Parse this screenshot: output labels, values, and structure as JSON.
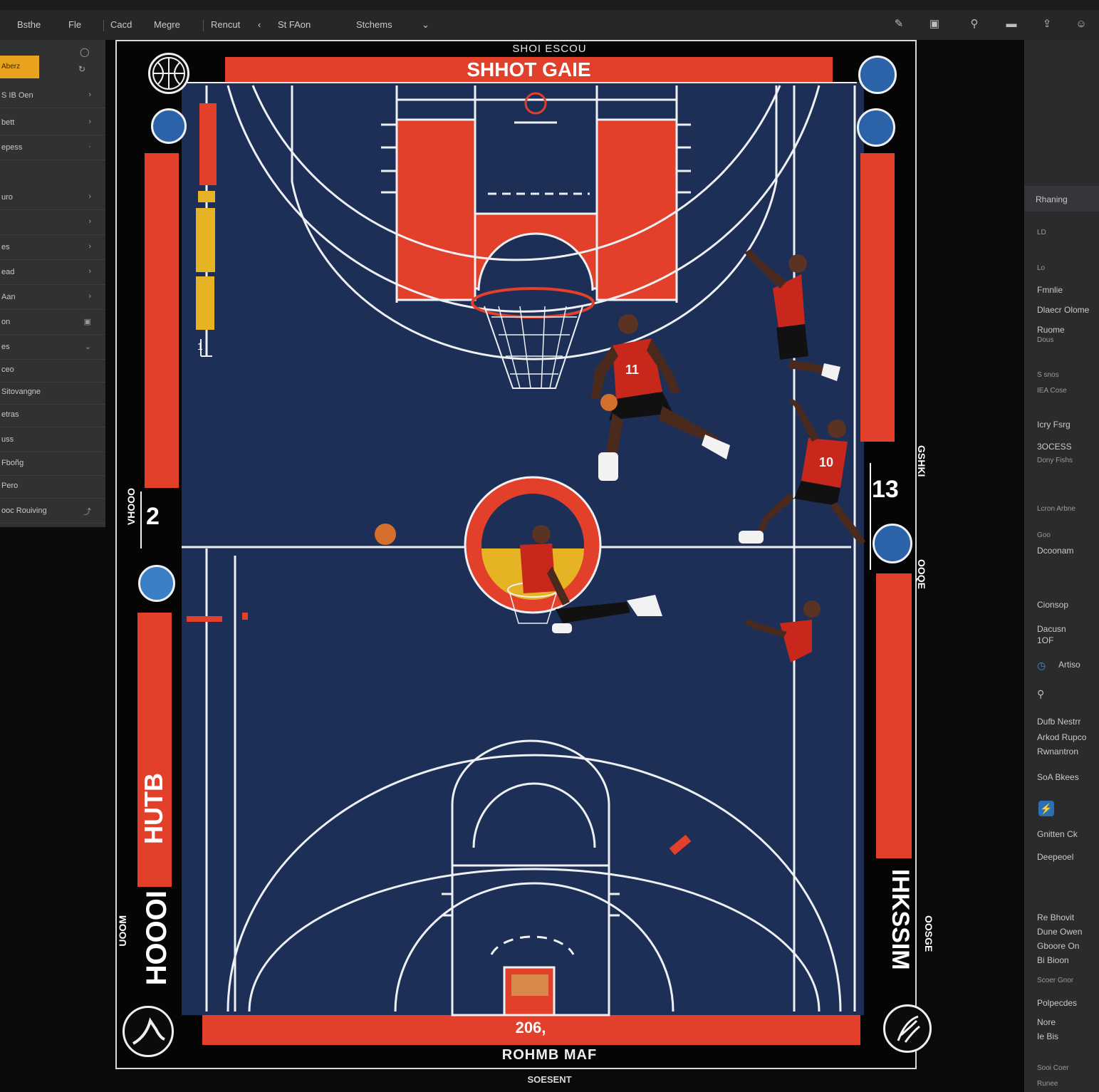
{
  "menubar": {
    "items": [
      "Bsthe",
      "Fle",
      "Cacd",
      "Megre",
      "Rencut",
      "St FAon",
      "Stchems"
    ],
    "tools": [
      "pen-icon",
      "layers-icon",
      "pin-icon",
      "toggle-icon",
      "share-icon",
      "user-icon"
    ]
  },
  "left_panel": {
    "active_item": "Aberz",
    "items": [
      {
        "label": "S IB Oen",
        "chevron": "›"
      },
      {
        "label": "bett",
        "chevron": "›"
      },
      {
        "label": "epess",
        "chevron": "·"
      },
      {
        "label": "uro",
        "chevron": "›"
      },
      {
        "label": "",
        "chevron": "›"
      },
      {
        "label": "es",
        "chevron": "›"
      },
      {
        "label": "ead",
        "chevron": "›"
      },
      {
        "label": "Aan",
        "chevron": "›"
      },
      {
        "label": "on",
        "chevron": "▣"
      },
      {
        "label": "es",
        "chevron": "⌄"
      },
      {
        "label": "ceo",
        "chevron": ""
      },
      {
        "label": "Sitovangne",
        "chevron": ""
      },
      {
        "label": "etras",
        "chevron": ""
      },
      {
        "label": "uss",
        "chevron": ""
      },
      {
        "label": "Fboñg",
        "chevron": ""
      },
      {
        "label": "Pero",
        "chevron": ""
      },
      {
        "label": "ooc Rouiving",
        "chevron": "⤴"
      }
    ]
  },
  "document": {
    "subtitle": "SHOI ESCOU",
    "banner_title": "SHHOT GAIE",
    "score_left": "2",
    "score_right": "13",
    "bottom_year": "206,",
    "footer_title": "ROHMB MAF",
    "footer_sub": "SOESENT",
    "left_vertical_main": "HOOOI",
    "left_vertical_orange": "HUTB",
    "left_vertical_small": "VHOOO",
    "left_vertical_small_bottom": "UOOM",
    "right_vertical_main": "IHKSSIM",
    "right_vertical_top": "GSHKI",
    "right_vertical_mid": "OOQE",
    "right_vertical_bottom": "OOSGE",
    "lane_label": "1",
    "jersey_numbers": [
      "11",
      "10"
    ],
    "logos": [
      "ball-logo",
      "team-logo-1",
      "team-logo-2",
      "team-logo-3",
      "team-logo-4",
      "team-logo-5",
      "swoosh-logo-left",
      "swoosh-logo-right"
    ]
  },
  "right_panel": {
    "header": "Rhaning",
    "entries": [
      {
        "text": "LD",
        "type": "sub"
      },
      {
        "text": "Lo",
        "type": "sub"
      },
      {
        "text": "Fmnlie",
        "type": "text"
      },
      {
        "text": "Dlaecr Olome",
        "type": "text"
      },
      {
        "text": "Ruome",
        "type": "text"
      },
      {
        "text": "Dous",
        "type": "sub"
      },
      {
        "text": "S snos",
        "type": "sub"
      },
      {
        "text": "IEA Cose",
        "type": "sub"
      },
      {
        "text": "Icry Fsrg",
        "type": "text"
      },
      {
        "text": "3OCESS",
        "type": "text"
      },
      {
        "text": "Dony Fishs",
        "type": "sub"
      },
      {
        "text": "Lcron Arbne",
        "type": "sub"
      },
      {
        "text": "Goo",
        "type": "sub"
      },
      {
        "text": "Dcoonam",
        "type": "text"
      },
      {
        "text": "Cionsop",
        "type": "text"
      },
      {
        "text": "Dacusn",
        "type": "text"
      },
      {
        "text": "1OF",
        "type": "text"
      },
      {
        "text": "Artiso",
        "type": "text"
      },
      {
        "text": "Dufb Nestrr",
        "type": "text"
      },
      {
        "text": "Arkod Rupco",
        "type": "text"
      },
      {
        "text": "Rwnantron",
        "type": "text"
      },
      {
        "text": "SoA Bkees",
        "type": "text"
      },
      {
        "text": "Gnitten Ck",
        "type": "text"
      },
      {
        "text": "Deepeoel",
        "type": "text"
      },
      {
        "text": "Re Bhovit",
        "type": "text"
      },
      {
        "text": "Dune Owen",
        "type": "text"
      },
      {
        "text": "Gboore On",
        "type": "text"
      },
      {
        "text": "Bi Bioon",
        "type": "text"
      },
      {
        "text": "Scoer Gnor",
        "type": "sub"
      },
      {
        "text": "Polpecdes",
        "type": "text"
      },
      {
        "text": "Nore",
        "type": "text"
      },
      {
        "text": "Ie Bis",
        "type": "text"
      },
      {
        "text": "Sooi Coer",
        "type": "sub"
      },
      {
        "text": "Runee",
        "type": "sub"
      }
    ]
  },
  "colors": {
    "court": "#1e2f57",
    "accent_red": "#e2402a",
    "accent_yellow": "#e5b324",
    "lines": "#eef0f4",
    "panel": "#303133",
    "highlight": "#e8a21e"
  }
}
